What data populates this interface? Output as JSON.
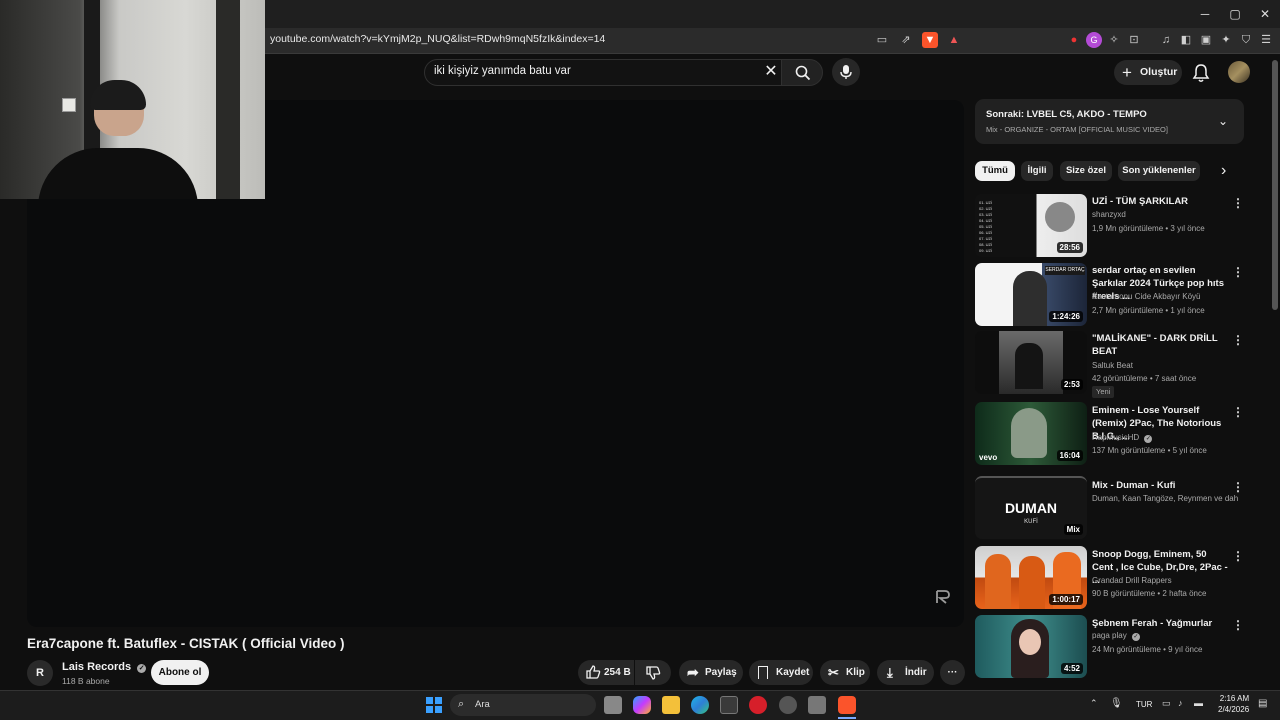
{
  "browser": {
    "url": "youtube.com/watch?v=kYmjM2p_NUQ&list=RDwh9mqN5fzIk&index=14"
  },
  "header": {
    "search_value": "iki kişiyiz yanımda batu var",
    "create_label": "Oluştur"
  },
  "video": {
    "title": "Era7capone ft. Batuflex - CISTAK ( Official Video )",
    "channel": "Lais Records",
    "subscribers": "118 B abone",
    "subscribe_label": "Abone ol",
    "likes": "254 B",
    "share_label": "Paylaş",
    "save_label": "Kaydet",
    "clip_label": "Klip",
    "download_label": "İndir"
  },
  "sidebar": {
    "next_label": "Sonraki: LVBEL C5, AKDO - TEMPO",
    "next_sub": "Mix - ORGANIZE - ORTAM [OFFICIAL MUSIC VIDEO]",
    "chips": [
      "Tümü",
      "İlgili",
      "Size özel",
      "Son yüklenenler"
    ],
    "videos": [
      {
        "title": "UZİ - TÜM ŞARKILAR",
        "channel": "shanzyxd",
        "meta": "1,9 Mn görüntüleme • 3 yıl önce",
        "duration": "28:56"
      },
      {
        "title": "serdar ortaç en sevilen Şarkılar 2024 Türkçe pop hıts #reels ...",
        "channel": "Kastamonu Cide Akbayır Köyü",
        "meta": "2,7 Mn görüntüleme • 1 yıl önce",
        "duration": "1:24:26"
      },
      {
        "title": "\"MALİKANE\" - DARK DRİLL BEAT",
        "channel": "Saltuk Beat",
        "meta": "42 görüntüleme • 7 saat önce",
        "duration": "2:53",
        "badge": "Yeni"
      },
      {
        "title": "Eminem - Lose Yourself (Remix) 2Pac, The Notorious B.I.G., ...",
        "channel": "RapMusicHD",
        "meta": "137 Mn görüntüleme • 5 yıl önce",
        "duration": "16:04"
      },
      {
        "title": "Mix - Duman - Kufi",
        "channel": "Duman, Kaan Tangöze, Reynmen ve dah...",
        "meta": "",
        "duration": "Mix"
      },
      {
        "title": "Snoop Dogg, Eminem, 50 Cent , Ice Cube, Dr,Dre, 2Pac - ...",
        "channel": "Grandad Drill Rappers",
        "meta": "90 B görüntüleme • 2 hafta önce",
        "duration": "1:00:17"
      },
      {
        "title": "Şebnem Ferah - Yağmurlar",
        "channel": "paga play",
        "meta": "24 Mn görüntüleme • 9 yıl önce",
        "duration": "4:52"
      }
    ]
  },
  "taskbar": {
    "search_label": "Ara",
    "lang": "TUR",
    "time": "2:16 AM",
    "date": "2/4/2026"
  },
  "thumb_text": {
    "duman": "DUMAN",
    "kufi": "KUFİ",
    "serdar": "SERDAR ORTAÇ",
    "vevo": "vevo"
  }
}
